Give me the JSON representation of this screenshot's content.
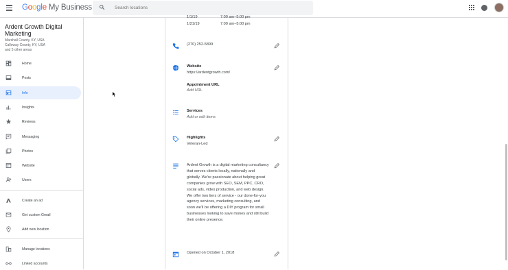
{
  "header": {
    "logo_g": "G",
    "logo_o1": "o",
    "logo_o2": "o",
    "logo_g2": "g",
    "logo_l": "l",
    "logo_e": "e",
    "product": "My Business",
    "search_placeholder": "Search locations"
  },
  "business": {
    "name": "Ardent Growth Digital Marketing",
    "address_lines": [
      "Marshall County, KY, USA",
      "Calloway County, KY, USA",
      "and 5 other areas"
    ]
  },
  "sidebar": {
    "items": [
      {
        "label": "Home",
        "icon": "home-icon"
      },
      {
        "label": "Posts",
        "icon": "posts-icon"
      },
      {
        "label": "Info",
        "icon": "info-icon",
        "active": true
      },
      {
        "label": "Insights",
        "icon": "insights-icon"
      },
      {
        "label": "Reviews",
        "icon": "star-icon"
      },
      {
        "label": "Messaging",
        "icon": "messaging-icon"
      },
      {
        "label": "Photos",
        "icon": "photos-icon"
      },
      {
        "label": "Website",
        "icon": "website-icon"
      },
      {
        "label": "Users",
        "icon": "users-icon"
      }
    ],
    "items2": [
      {
        "label": "Create an ad",
        "icon": "ads-icon"
      },
      {
        "label": "Get custom Gmail",
        "icon": "gmail-icon"
      },
      {
        "label": "Add new location",
        "icon": "location-icon"
      }
    ],
    "items3": [
      {
        "label": "Manage locations",
        "icon": "manage-locations-icon"
      },
      {
        "label": "Linked accounts",
        "icon": "link-icon"
      }
    ]
  },
  "info": {
    "hours": [
      {
        "date": "1/1/19",
        "time": "7:00 am–5:00 pm"
      },
      {
        "date": "1/21/19",
        "time": "7:00 am–5:00 pm"
      }
    ],
    "phone": "(270) 252-5899",
    "website_label": "Website",
    "website_url": "https://ardentgrowth.com/",
    "appointment_label": "Appointment URL",
    "appointment_value": "Add URL",
    "services_label": "Services",
    "services_value": "Add or edit items",
    "highlights_label": "Highlights",
    "highlights_value": "Veteran-Led",
    "description": "Ardent Growth is a digital marketing consultancy that serves clients locally, nationally and globally. We're passionate about helping great companies grow with SEO, SEM, PPC, CRO, social ads, video production, and web design. We offer two tiers of service - our done-for-you agency services, marketing consulting, and soon we'll be offering a DIY program for small businesses looking to save money and still build their online presence.",
    "opened": "Opened on October 1, 2018"
  },
  "colors": {
    "accent": "#1a73e8",
    "active_bg": "#e8f0fe",
    "icon": "#5f6368"
  }
}
